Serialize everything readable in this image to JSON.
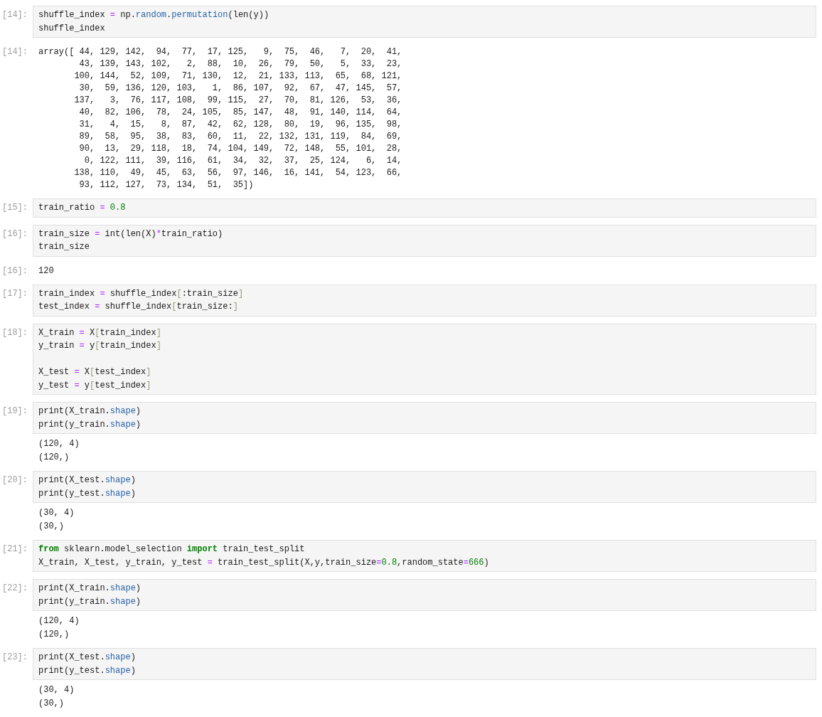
{
  "cells": [
    {
      "prompt": "[14]:",
      "input": [
        [
          "shuffle_index ",
          {
            "text": "=",
            "kind": "op"
          },
          " np.",
          {
            "text": "random",
            "kind": "prop"
          },
          ".",
          {
            "text": "permutation",
            "kind": "prop"
          },
          "(len(y))"
        ],
        [
          "shuffle_index"
        ]
      ],
      "output": {
        "kind": "result",
        "prompt": "[14]:",
        "lines": [
          "array([ 44, 129, 142,  94,  77,  17, 125,   9,  75,  46,   7,  20,  41,",
          "        43, 139, 143, 102,   2,  88,  10,  26,  79,  50,   5,  33,  23,",
          "       100, 144,  52, 109,  71, 130,  12,  21, 133, 113,  65,  68, 121,",
          "        30,  59, 136, 120, 103,   1,  86, 107,  92,  67,  47, 145,  57,",
          "       137,   3,  76, 117, 108,  99, 115,  27,  70,  81, 126,  53,  36,",
          "        40,  82, 106,  78,  24, 105,  85, 147,  48,  91, 140, 114,  64,",
          "        31,   4,  15,   8,  87,  42,  62, 128,  80,  19,  96, 135,  98,",
          "        89,  58,  95,  38,  83,  60,  11,  22, 132, 131, 119,  84,  69,",
          "        90,  13,  29, 118,  18,  74, 104, 149,  72, 148,  55, 101,  28,",
          "         0, 122, 111,  39, 116,  61,  34,  32,  37,  25, 124,   6,  14,",
          "       138, 110,  49,  45,  63,  56,  97, 146,  16, 141,  54, 123,  66,",
          "        93, 112, 127,  73, 134,  51,  35])"
        ]
      }
    },
    {
      "prompt": "[15]:",
      "input": [
        [
          "train_ratio ",
          {
            "text": "= ",
            "kind": "op"
          },
          {
            "text": "0.8",
            "kind": "num"
          }
        ]
      ]
    },
    {
      "prompt": "[16]:",
      "input": [
        [
          "train_size ",
          {
            "text": "=",
            "kind": "op"
          },
          " int(len(X)",
          {
            "text": "*",
            "kind": "op"
          },
          "train_ratio)"
        ],
        [
          "train_size"
        ]
      ],
      "output": {
        "kind": "result",
        "prompt": "[16]:",
        "lines": [
          "120"
        ]
      }
    },
    {
      "prompt": "[17]:",
      "input": [
        [
          "train_index ",
          {
            "text": "=",
            "kind": "op"
          },
          " shuffle_index",
          {
            "text": "[",
            "kind": "bracket"
          },
          ":train_size",
          {
            "text": "]",
            "kind": "bracket"
          }
        ],
        [
          "test_index ",
          {
            "text": "=",
            "kind": "op"
          },
          " shuffle_index",
          {
            "text": "[",
            "kind": "bracket"
          },
          "train_size:",
          {
            "text": "]",
            "kind": "bracket"
          }
        ]
      ]
    },
    {
      "prompt": "[18]:",
      "input": [
        [
          "X_train ",
          {
            "text": "=",
            "kind": "op"
          },
          " X",
          {
            "text": "[",
            "kind": "bracket"
          },
          "train_index",
          {
            "text": "]",
            "kind": "bracket"
          }
        ],
        [
          "y_train ",
          {
            "text": "=",
            "kind": "op"
          },
          " y",
          {
            "text": "[",
            "kind": "bracket"
          },
          "train_index",
          {
            "text": "]",
            "kind": "bracket"
          }
        ],
        {
          "gap_before": true,
          "tokens": [
            "X_test ",
            {
              "text": "=",
              "kind": "op"
            },
            " X",
            {
              "text": "[",
              "kind": "bracket"
            },
            "test_index",
            {
              "text": "]",
              "kind": "bracket"
            }
          ]
        },
        [
          "y_test ",
          {
            "text": "=",
            "kind": "op"
          },
          " y",
          {
            "text": "[",
            "kind": "bracket"
          },
          "test_index",
          {
            "text": "]",
            "kind": "bracket"
          }
        ]
      ]
    },
    {
      "prompt": "[19]:",
      "input": [
        [
          "print(X_train.",
          {
            "text": "shape",
            "kind": "prop"
          },
          ")"
        ],
        [
          "print(y_train.",
          {
            "text": "shape",
            "kind": "prop"
          },
          ")"
        ]
      ],
      "output": {
        "kind": "stream",
        "lines": [
          "(120, 4)",
          "(120,)"
        ]
      }
    },
    {
      "prompt": "[20]:",
      "input": [
        [
          "print(X_test.",
          {
            "text": "shape",
            "kind": "prop"
          },
          ")"
        ],
        [
          "print(y_test.",
          {
            "text": "shape",
            "kind": "prop"
          },
          ")"
        ]
      ],
      "output": {
        "kind": "stream",
        "lines": [
          "(30, 4)",
          "(30,)"
        ]
      }
    },
    {
      "prompt": "[21]:",
      "input": [
        [
          {
            "text": "from",
            "kind": "kw"
          },
          " sklearn.model_selection ",
          {
            "text": "import",
            "kind": "kw"
          },
          " train_test_split"
        ],
        [
          "X_train, X_test, y_train, y_test ",
          {
            "text": "=",
            "kind": "op"
          },
          " train_test_split(X,y,train_size",
          {
            "text": "=",
            "kind": "op"
          },
          {
            "text": "0.8",
            "kind": "num"
          },
          ",random_state",
          {
            "text": "=",
            "kind": "op"
          },
          {
            "text": "666",
            "kind": "num"
          },
          ")"
        ]
      ]
    },
    {
      "prompt": "[22]:",
      "input": [
        [
          "print(X_train.",
          {
            "text": "shape",
            "kind": "prop"
          },
          ")"
        ],
        [
          "print(y_train.",
          {
            "text": "shape",
            "kind": "prop"
          },
          ")"
        ]
      ],
      "output": {
        "kind": "stream",
        "lines": [
          "(120, 4)",
          "(120,)"
        ]
      }
    },
    {
      "prompt": "[23]:",
      "input": [
        [
          "print(X_test.",
          {
            "text": "shape",
            "kind": "prop"
          },
          ")"
        ],
        [
          "print(y_test.",
          {
            "text": "shape",
            "kind": "prop"
          },
          ")"
        ]
      ],
      "output": {
        "kind": "stream",
        "lines": [
          "(30, 4)",
          "(30,)"
        ]
      }
    }
  ]
}
